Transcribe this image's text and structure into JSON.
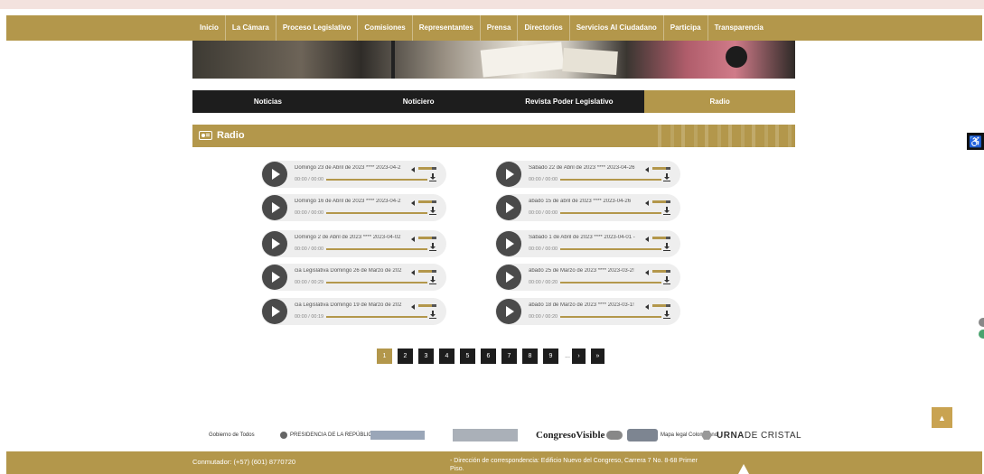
{
  "nav": {
    "items": [
      "Inicio",
      "La Cámara",
      "Proceso Legislativo",
      "Comisiones",
      "Representantes",
      "Prensa",
      "Directorios",
      "Servicios Al Ciudadano",
      "Participa",
      "Transparencia"
    ]
  },
  "tabs": [
    {
      "label": "Noticias",
      "active": false
    },
    {
      "label": "Noticiero",
      "active": false
    },
    {
      "label": "Revista Poder Legislativo",
      "active": false
    },
    {
      "label": "Radio",
      "active": true
    }
  ],
  "section": {
    "title": "Radio",
    "icon": "radio-icon"
  },
  "players": [
    {
      "title": "Domingo 23 de Abril de 2023 **** 2023-04-2",
      "time": "00:00 / 00:00"
    },
    {
      "title": "Sábado 22 de Abril de 2023 **** 2023-04-26",
      "time": "00:00 / 00:00"
    },
    {
      "title": "Domingo 16 de Abril de 2023 **** 2023-04-2",
      "time": "00:00 / 00:00"
    },
    {
      "title": "ábado 15 de abril de 2023 **** 2023-04-26",
      "time": "00:00 / 00:00"
    },
    {
      "title": "Domingo 2 de Abril de 2023 **** 2023-04-02",
      "time": "00:00 / 00:00"
    },
    {
      "title": "Sábado 1 de Abril de 2023 **** 2023-04-01 -",
      "time": "00:00 / 00:00"
    },
    {
      "title": "cia Legislativa Domingo 26 de Marzo de 202",
      "time": "00:00 / 00:29"
    },
    {
      "title": "ábado 25 de Marzo de 2023 **** 2023-03-2!",
      "time": "00:00 / 00:20"
    },
    {
      "title": "cia Legislativa Domingo 19 de Marzo de 202",
      "time": "00:00 / 00:19"
    },
    {
      "title": "ábado 18 de Marzo de 2023 **** 2023-03-1!",
      "time": "00:00 / 00:20"
    }
  ],
  "pagination": {
    "pages": [
      "1",
      "2",
      "3",
      "4",
      "5",
      "6",
      "7",
      "8",
      "9"
    ],
    "current": "1",
    "ellipsis": "...",
    "next": "›",
    "last": "»"
  },
  "logos": {
    "gobierno": "Gobierno de Todos",
    "presidencia": "PRESIDENCIA DE LA REPÚBLICA",
    "congreso_visible": "CongresoVisible",
    "urna_1": "URNA",
    "urna_2": " DE CRISTAL",
    "mapa_legal": "Mapa legal Colombiano"
  },
  "footer": {
    "phone": "Conmutador: (+57) (601) 8770720",
    "address": "- Dirección de correspondencia: Edificio Nuevo del Congreso, Carrera 7 No. 8-68 Primer Piso."
  },
  "scroll_top_label": "▲",
  "a11y_label": "♿",
  "colors": {
    "gold": "#b3974b",
    "dark": "#1d1d1d",
    "player_bg": "#eeeeee"
  }
}
